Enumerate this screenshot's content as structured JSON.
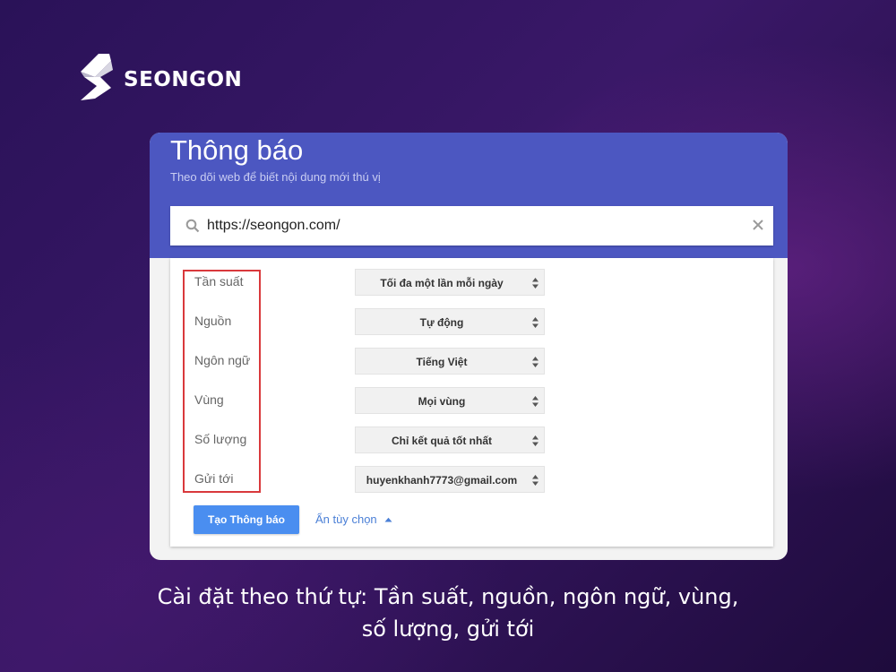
{
  "brand": {
    "name": "SEONGON"
  },
  "alerts": {
    "title": "Thông báo",
    "subtitle": "Theo dõi web để biết nội dung mới thú vị",
    "search_value": "https://seongon.com/",
    "search_icon": "search-icon",
    "clear_icon": "close-icon",
    "options": [
      {
        "label": "Tần suất",
        "value": "Tối đa một lần mỗi ngày"
      },
      {
        "label": "Nguồn",
        "value": "Tự động"
      },
      {
        "label": "Ngôn ngữ",
        "value": "Tiếng Việt"
      },
      {
        "label": "Vùng",
        "value": "Mọi vùng"
      },
      {
        "label": "Số lượng",
        "value": "Chỉ kết quả tốt nhất"
      },
      {
        "label": "Gửi tới",
        "value": "huyenkhanh7773@gmail.com"
      }
    ],
    "create_button": "Tạo Thông báo",
    "hide_options": "Ẩn tùy chọn"
  },
  "caption": {
    "line1": "Cài đặt theo thứ tự: Tần suất, nguồn, ngôn ngữ, vùng,",
    "line2": "số lượng, gửi tới"
  },
  "colors": {
    "header": "#4c57c1",
    "button": "#4a8ef0",
    "highlight": "#d9393c",
    "link": "#4a7fd6"
  }
}
